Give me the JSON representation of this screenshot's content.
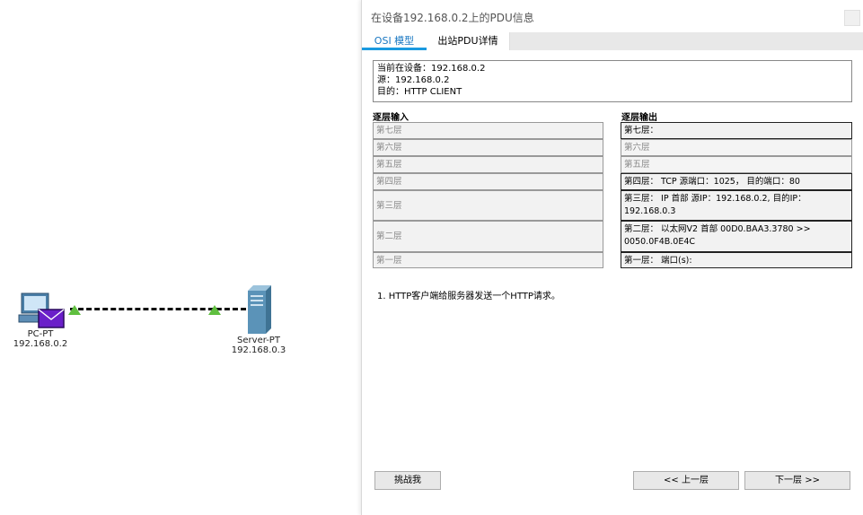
{
  "workspace": {
    "devices": [
      {
        "name": "PC-PT",
        "ip": "192.168.0.2",
        "icon": "pc-icon"
      },
      {
        "name": "Server-PT",
        "ip": "192.168.0.3",
        "icon": "server-icon"
      }
    ],
    "pdu_envelope_color": "#6a1fc9",
    "link_arrow_color": "#5fbf3f"
  },
  "dialog": {
    "title": "在设备192.168.0.2上的PDU信息",
    "tabs": [
      {
        "label": "OSI 模型",
        "active": true
      },
      {
        "label": "出站PDU详情",
        "active": false
      }
    ],
    "info": {
      "current_device": "当前在设备：192.168.0.2",
      "source": "源：192.168.0.2",
      "destination": "目的：HTTP CLIENT"
    },
    "in_layers_heading": "逐层输入",
    "out_layers_heading": "逐层输出",
    "in_layers": [
      "第七层",
      "第六层",
      "第五层",
      "第四层",
      "第三层",
      "第二层",
      "第一层"
    ],
    "out_layers": [
      "第七层：",
      "第六层",
      "第五层",
      "第四层： TCP 源端口：1025， 目的端口：80",
      "第三层： IP 首部 源IP：192.168.0.2, 目的IP：192.168.0.3",
      "第二层： 以太网V2 首部 00D0.BAA3.3780 >> 0050.0F4B.0E4C",
      "第一层： 端口(s):"
    ],
    "description": "1. HTTP客户端给服务器发送一个HTTP请求。",
    "buttons": {
      "challenge": "挑战我",
      "prev_layer": "<< 上一层",
      "next_layer": "下一层 >>"
    }
  }
}
